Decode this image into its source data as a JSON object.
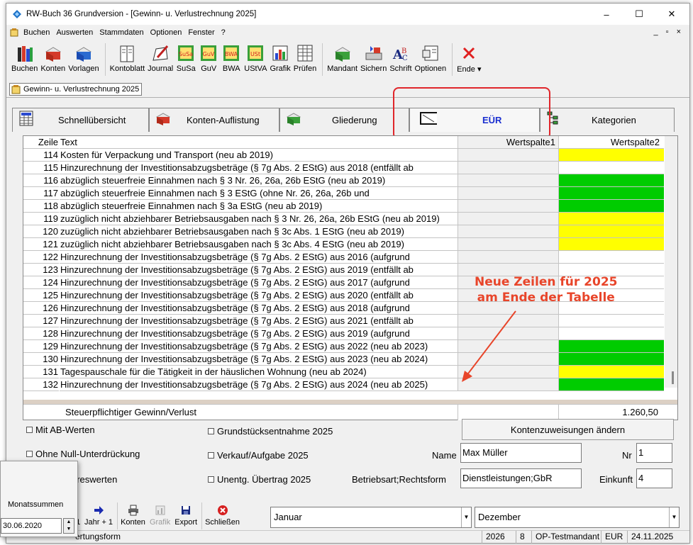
{
  "window": {
    "title": "RW-Buch 36 Grundversion  - [Gewinn- u. Verlustrechnung 2025]",
    "controls": [
      "–",
      "☐",
      "✕"
    ]
  },
  "menu": {
    "items": [
      "Buchen",
      "Auswerten",
      "Stammdaten",
      "Optionen",
      "Fenster",
      "?"
    ],
    "mdi_controls": "_ ▫ ×"
  },
  "toolbar": {
    "buttons": [
      "Buchen",
      "Konten",
      "Vorlagen",
      "Kontoblatt",
      "Journal",
      "SuSa",
      "GuV",
      "BWA",
      "UStVA",
      "Grafik",
      "Prüfen",
      "Mandant",
      "Sichern",
      "Schrift",
      "Optionen",
      "Ende"
    ],
    "icon_texts": {
      "susa": "SuSa",
      "guv": "GuV",
      "bwa": "BWA",
      "ust": "USt"
    }
  },
  "doc_tab": {
    "label": "Gewinn- u. Verlustrechnung 2025"
  },
  "tabs": [
    {
      "label": "Schnellübersicht",
      "icon": "grid-calculator-icon"
    },
    {
      "label": "Konten-Auflistung",
      "icon": "ledger-book-icon"
    },
    {
      "label": "Gliederung",
      "icon": "book-tree-icon"
    },
    {
      "label": "EÜR",
      "icon": "form-sheet-icon",
      "active": true
    },
    {
      "label": "Kategorien",
      "icon": "tree-icon"
    }
  ],
  "table": {
    "headers": {
      "zeile": "Zeile",
      "text": "Text",
      "w1": "Wertspalte1",
      "w2": "Wertspalte2"
    },
    "rows": [
      {
        "zeile": "114",
        "text": "Kosten für Verpackung und Transport (neu ab 2019)",
        "w2_color": "#ffff00"
      },
      {
        "zeile": "115",
        "text": "Hinzurechnung der Investitionsabzugsbeträge (§ 7g Abs. 2 EStG) aus 2018 (entfällt ab",
        "w2_color": "#ffffff"
      },
      {
        "zeile": "116",
        "text": "abzüglich steuerfreie Einnahmen nach § 3 Nr. 26, 26a, 26b EStG (neu ab 2019)",
        "w2_color": "#00cc00"
      },
      {
        "zeile": "117",
        "text": "abzüglich steuerfreie Einnahmen nach § 3 EStG (ohne Nr. 26, 26a, 26b und",
        "w2_color": "#00cc00"
      },
      {
        "zeile": "118",
        "text": "abzüglich steuerfreie Einnahmen nach § 3a EStG (neu ab 2019)",
        "w2_color": "#00cc00"
      },
      {
        "zeile": "119",
        "text": "zuzüglich nicht abziehbarer Betriebsausgaben nach § 3 Nr. 26, 26a, 26b EStG (neu ab 2019)",
        "w2_color": "#ffff00"
      },
      {
        "zeile": "120",
        "text": "zuzüglich nicht abziehbarer Betriebsausgaben nach § 3c Abs. 1 EStG (neu ab 2019)",
        "w2_color": "#ffff00"
      },
      {
        "zeile": "121",
        "text": "zuzüglich nicht abziehbarer Betriebsausgaben nach § 3c Abs. 4 EStG (neu ab 2019)",
        "w2_color": "#ffff00"
      },
      {
        "zeile": "122",
        "text": "Hinzurechnung der Investitionsabzugsbeträge (§ 7g Abs. 2 EStG) aus 2016 (aufgrund",
        "w2_color": "#ffffff"
      },
      {
        "zeile": "123",
        "text": "Hinzurechnung der Investitionsabzugsbeträge (§ 7g Abs. 2 EStG) aus 2019 (entfällt ab",
        "w2_color": "#ffffff"
      },
      {
        "zeile": "124",
        "text": "Hinzurechnung der Investitionsabzugsbeträge (§ 7g Abs. 2 EStG) aus 2017 (aufgrund",
        "w2_color": "#ffffff"
      },
      {
        "zeile": "125",
        "text": "Hinzurechnung der Investitionsabzugsbeträge (§ 7g Abs. 2 EStG) aus 2020 (entfällt ab",
        "w2_color": "#ffffff"
      },
      {
        "zeile": "126",
        "text": "Hinzurechnung der Investitionsabzugsbeträge (§ 7g Abs. 2 EStG) aus 2018 (aufgrund",
        "w2_color": "#ffffff"
      },
      {
        "zeile": "127",
        "text": "Hinzurechnung der Investitionsabzugsbeträge (§ 7g Abs. 2 EStG) aus 2021 (entfällt ab",
        "w2_color": "#ffffff"
      },
      {
        "zeile": "128",
        "text": "Hinzurechnung der Investitionsabzugsbeträge (§ 7g Abs. 2 EStG) aus 2019 (aufgrund",
        "w2_color": "#ffffff"
      },
      {
        "zeile": "129",
        "text": "Hinzurechnung der Investitionsabzugsbeträge (§ 7g Abs. 2 EStG) aus 2022 (neu ab 2023)",
        "w2_color": "#00cc00"
      },
      {
        "zeile": "130",
        "text": "Hinzurechnung der Investitionsabzugsbeträge (§ 7g Abs. 2 EStG) aus 2023 (neu ab 2024)",
        "w2_color": "#00cc00"
      },
      {
        "zeile": "131",
        "text": "Tagespauschale für die Tätigkeit in der häuslichen Wohnung (neu ab 2024)",
        "w2_color": "#ffff00"
      },
      {
        "zeile": "132",
        "text": "Hinzurechnung der Investitionsabzugsbeträge (§ 7g Abs. 2 EStG) aus 2024 (neu ab 2025)",
        "w2_color": "#00cc00"
      }
    ],
    "summary": {
      "label": "Steuerpflichtiger Gewinn/Verlust",
      "w2": "1.260,50"
    }
  },
  "annotation": {
    "line1": "Neue Zeilen für 2025",
    "line2": "am Ende der Tabelle",
    "color": "#e8452a"
  },
  "options": {
    "mit_ab": "Mit AB-Werten",
    "ohne_null": "Ohne Null-Unterdrückung",
    "vorjahr_partial": "hreswerten",
    "grundstueck": "Grundstücksentnahme 2025",
    "verkauf": "Verkauf/Aufgabe 2025",
    "unentg": "Unentg. Übertrag 2025"
  },
  "form": {
    "button": "Kontenzuweisungen ändern",
    "name_label": "Name",
    "name_value": "Max Müller",
    "nr_label": "Nr",
    "nr_value": "1",
    "betriebsart_label": "Betriebsart;Rechtsform",
    "betriebsart_value": "Dienstleistungen;GbR",
    "einkunft_label": "Einkunft",
    "einkunft_value": "4"
  },
  "bottom": {
    "minus1": "- 1",
    "jahr_plus": "Jahr + 1",
    "konten": "Konten",
    "grafik": "Grafik",
    "export": "Export",
    "schliessen": "Schließen",
    "from_month": "Januar",
    "to_month": "Dezember",
    "auswertungsform_partial": "ertungsform"
  },
  "popup": {
    "label": "Monatssummen",
    "value": "30.06.2020"
  },
  "status": [
    "2026",
    "8",
    "OP-Testmandant",
    "EUR",
    "24.11.2025"
  ]
}
